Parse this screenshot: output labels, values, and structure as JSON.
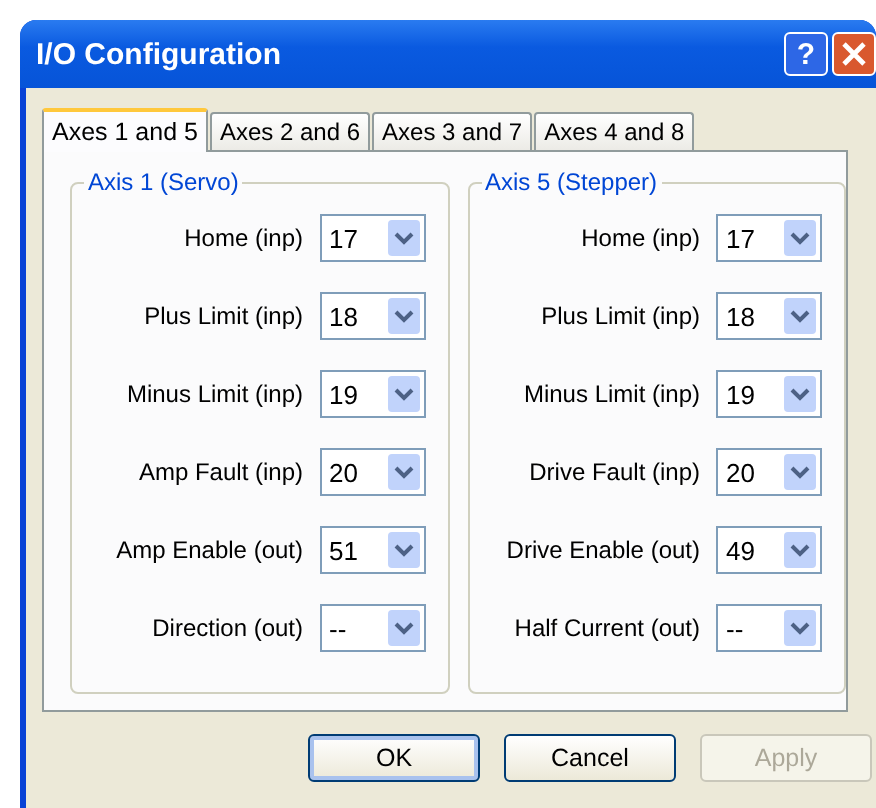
{
  "window": {
    "title": "I/O Configuration",
    "help_button": "?"
  },
  "tabs": [
    {
      "label": "Axes 1 and 5",
      "selected": true
    },
    {
      "label": "Axes 2 and 6",
      "selected": false
    },
    {
      "label": "Axes 3 and 7",
      "selected": false
    },
    {
      "label": "Axes 4 and 8",
      "selected": false
    }
  ],
  "groups": [
    {
      "title": "Axis 1 (Servo)",
      "fields": [
        {
          "label": "Home (inp)",
          "value": "17"
        },
        {
          "label": "Plus Limit (inp)",
          "value": "18"
        },
        {
          "label": "Minus Limit (inp)",
          "value": "19"
        },
        {
          "label": "Amp Fault (inp)",
          "value": "20"
        },
        {
          "label": "Amp Enable (out)",
          "value": "51"
        },
        {
          "label": "Direction (out)",
          "value": "--"
        }
      ]
    },
    {
      "title": "Axis 5 (Stepper)",
      "fields": [
        {
          "label": "Home (inp)",
          "value": "17"
        },
        {
          "label": "Plus Limit (inp)",
          "value": "18"
        },
        {
          "label": "Minus Limit (inp)",
          "value": "19"
        },
        {
          "label": "Drive Fault (inp)",
          "value": "20"
        },
        {
          "label": "Drive Enable (out)",
          "value": "49"
        },
        {
          "label": "Half Current (out)",
          "value": "--"
        }
      ]
    }
  ],
  "buttons": [
    {
      "label": "OK",
      "default": true,
      "disabled": false
    },
    {
      "label": "Cancel",
      "default": false,
      "disabled": false
    },
    {
      "label": "Apply",
      "default": false,
      "disabled": true
    }
  ]
}
